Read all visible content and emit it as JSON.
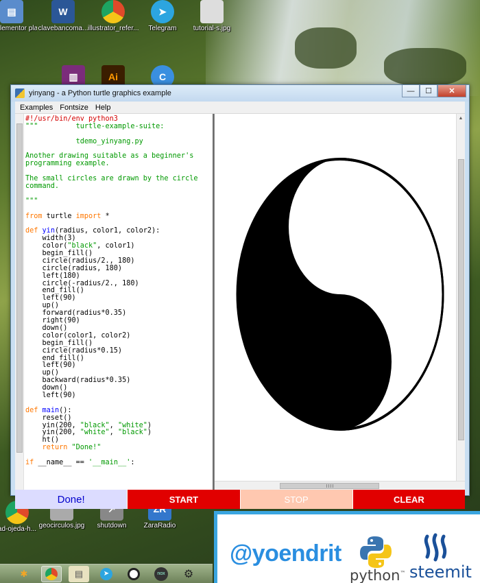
{
  "desktop": {
    "icons": [
      {
        "label": "ka Elementor plate Pack",
        "color": "#5a8ccc"
      },
      {
        "label": "clavebancoma...",
        "color": "#2b5797"
      },
      {
        "label": "illustrator_refer...",
        "color": "#e04a2a"
      },
      {
        "label": "Telegram",
        "color": "#2ca5e0"
      },
      {
        "label": "tutorial-s.jpg",
        "color": "#cccccc"
      },
      {
        "label": "ad-ojeda-h...",
        "color": "#1da462"
      },
      {
        "label": "geocirculos.jpg",
        "color": "#999999"
      },
      {
        "label": "shutdown",
        "color": "#777777"
      },
      {
        "label": "ZaraRadio",
        "color": "#3377cc"
      }
    ]
  },
  "window": {
    "title": "yinyang - a Python turtle graphics example",
    "controls": {
      "minimize": "—",
      "maximize": "☐",
      "close": "✕"
    },
    "menu": [
      "Examples",
      "Fontsize",
      "Help"
    ],
    "code_lines": [
      [
        [
          "c-comment",
          "#!/usr/bin/env python3"
        ]
      ],
      [
        [
          "c-str",
          "\"\"\"         turtle-example-suite:"
        ]
      ],
      [
        [
          "c-str",
          ""
        ]
      ],
      [
        [
          "c-str",
          "            tdemo_yinyang.py"
        ]
      ],
      [
        [
          "c-str",
          ""
        ]
      ],
      [
        [
          "c-str",
          "Another drawing suitable as a beginner's"
        ]
      ],
      [
        [
          "c-str",
          "programming example."
        ]
      ],
      [
        [
          "c-str",
          ""
        ]
      ],
      [
        [
          "c-str",
          "The small circles are drawn by the circle"
        ]
      ],
      [
        [
          "c-str",
          "command."
        ]
      ],
      [
        [
          "c-str",
          ""
        ]
      ],
      [
        [
          "c-str",
          "\"\"\""
        ]
      ],
      [
        [
          "c-plain",
          ""
        ]
      ],
      [
        [
          "c-kw",
          "from"
        ],
        [
          "c-plain",
          " turtle "
        ],
        [
          "c-kw",
          "import"
        ],
        [
          "c-plain",
          " *"
        ]
      ],
      [
        [
          "c-plain",
          ""
        ]
      ],
      [
        [
          "c-kw",
          "def"
        ],
        [
          "c-plain",
          " "
        ],
        [
          "c-def",
          "yin"
        ],
        [
          "c-plain",
          "(radius, color1, color2):"
        ]
      ],
      [
        [
          "c-plain",
          "    width(3)"
        ]
      ],
      [
        [
          "c-plain",
          "    color("
        ],
        [
          "c-str",
          "\"black\""
        ],
        [
          "c-plain",
          ", color1)"
        ]
      ],
      [
        [
          "c-plain",
          "    begin_fill()"
        ]
      ],
      [
        [
          "c-plain",
          "    circle(radius/2., 180)"
        ]
      ],
      [
        [
          "c-plain",
          "    circle(radius, 180)"
        ]
      ],
      [
        [
          "c-plain",
          "    left(180)"
        ]
      ],
      [
        [
          "c-plain",
          "    circle(-radius/2., 180)"
        ]
      ],
      [
        [
          "c-plain",
          "    end_fill()"
        ]
      ],
      [
        [
          "c-plain",
          "    left(90)"
        ]
      ],
      [
        [
          "c-plain",
          "    up()"
        ]
      ],
      [
        [
          "c-plain",
          "    forward(radius*0.35)"
        ]
      ],
      [
        [
          "c-plain",
          "    right(90)"
        ]
      ],
      [
        [
          "c-plain",
          "    down()"
        ]
      ],
      [
        [
          "c-plain",
          "    color(color1, color2)"
        ]
      ],
      [
        [
          "c-plain",
          "    begin_fill()"
        ]
      ],
      [
        [
          "c-plain",
          "    circle(radius*0.15)"
        ]
      ],
      [
        [
          "c-plain",
          "    end_fill()"
        ]
      ],
      [
        [
          "c-plain",
          "    left(90)"
        ]
      ],
      [
        [
          "c-plain",
          "    up()"
        ]
      ],
      [
        [
          "c-plain",
          "    backward(radius*0.35)"
        ]
      ],
      [
        [
          "c-plain",
          "    down()"
        ]
      ],
      [
        [
          "c-plain",
          "    left(90)"
        ]
      ],
      [
        [
          "c-plain",
          ""
        ]
      ],
      [
        [
          "c-kw",
          "def"
        ],
        [
          "c-plain",
          " "
        ],
        [
          "c-def",
          "main"
        ],
        [
          "c-plain",
          "():"
        ]
      ],
      [
        [
          "c-plain",
          "    reset()"
        ]
      ],
      [
        [
          "c-plain",
          "    yin(200, "
        ],
        [
          "c-str",
          "\"black\""
        ],
        [
          "c-plain",
          ", "
        ],
        [
          "c-str",
          "\"white\""
        ],
        [
          "c-plain",
          ")"
        ]
      ],
      [
        [
          "c-plain",
          "    yin(200, "
        ],
        [
          "c-str",
          "\"white\""
        ],
        [
          "c-plain",
          ", "
        ],
        [
          "c-str",
          "\"black\""
        ],
        [
          "c-plain",
          ")"
        ]
      ],
      [
        [
          "c-plain",
          "    ht()"
        ]
      ],
      [
        [
          "c-plain",
          "    "
        ],
        [
          "c-kw",
          "return"
        ],
        [
          "c-plain",
          " "
        ],
        [
          "c-str",
          "\"Done!\""
        ]
      ],
      [
        [
          "c-plain",
          ""
        ]
      ],
      [
        [
          "c-kw",
          "if"
        ],
        [
          "c-plain",
          " __name__ == "
        ],
        [
          "c-str",
          "'__main__'"
        ],
        [
          "c-plain",
          ":"
        ]
      ]
    ],
    "buttons": {
      "done": "Done!",
      "start": "START",
      "stop": "STOP",
      "clear": "CLEAR"
    }
  },
  "watermark": {
    "handle": "@yoendrit",
    "python_word": "python",
    "python_tm": "™",
    "steemit_word": "steemit"
  }
}
